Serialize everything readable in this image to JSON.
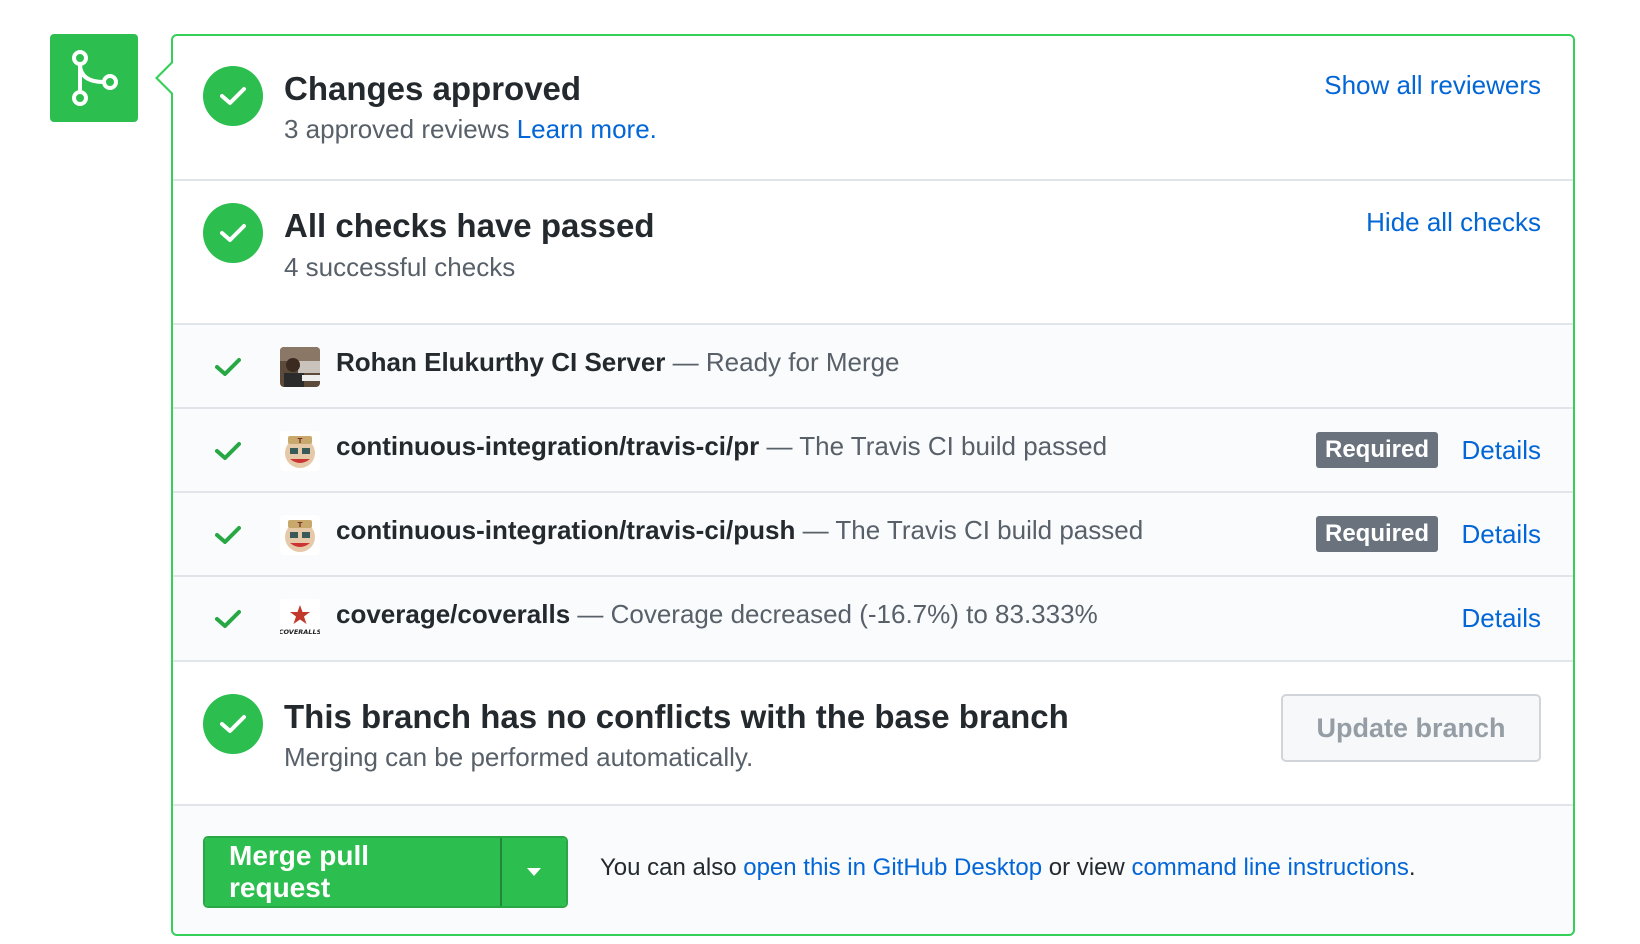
{
  "approved": {
    "title": "Changes approved",
    "subtitle": "3 approved reviews",
    "learn_more": "Learn more.",
    "show_reviewers": "Show all reviewers"
  },
  "checks": {
    "title": "All checks have passed",
    "subtitle": "4 successful checks",
    "hide_checks": "Hide all checks",
    "items": [
      {
        "context": "Rohan Elukurthy CI Server",
        "description": "— Ready for Merge",
        "required": false,
        "details": ""
      },
      {
        "context": "continuous-integration/travis-ci/pr",
        "description": "— The Travis CI build passed",
        "required": true,
        "required_label": "Required",
        "details": "Details"
      },
      {
        "context": "continuous-integration/travis-ci/push",
        "description": "— The Travis CI build passed",
        "required": true,
        "required_label": "Required",
        "details": "Details"
      },
      {
        "context": "coverage/coveralls",
        "description": "— Coverage decreased (-16.7%) to 83.333%",
        "required": false,
        "details": "Details",
        "avatar_text": "COVERALLS"
      }
    ]
  },
  "branch": {
    "title": "This branch has no conflicts with the base branch",
    "subtitle": "Merging can be performed automatically.",
    "update_button": "Update branch"
  },
  "merge": {
    "button": "Merge pull request",
    "note_prefix": "You can also",
    "desktop_link": "open this in GitHub Desktop",
    "note_middle": "or view",
    "cli_link": "command line instructions",
    "note_suffix": "."
  },
  "colors": {
    "success_green": "#2cbe4e",
    "border_green": "#34d058",
    "link_blue": "#0366d6",
    "badge_gray": "#6a737d"
  },
  "icons": {
    "merge": "git-merge-icon",
    "status": "check-circle-icon",
    "row_status": "check-icon",
    "dropdown": "triangle-down-icon"
  }
}
